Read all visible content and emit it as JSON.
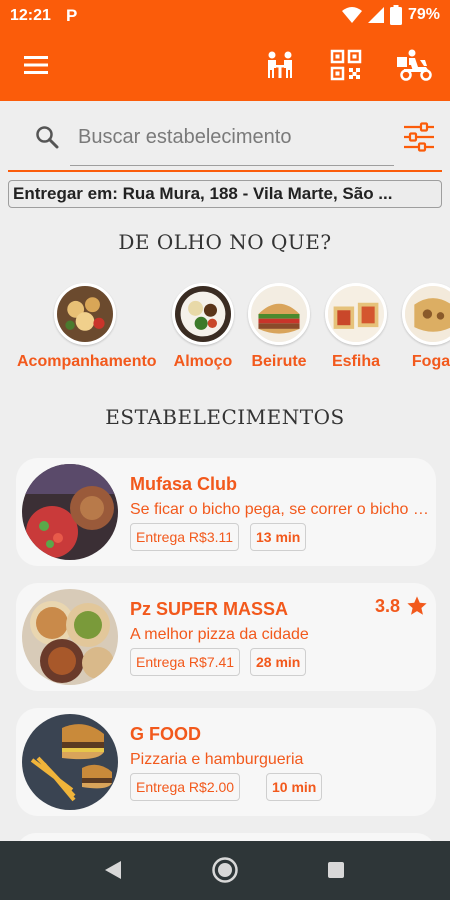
{
  "status_bar": {
    "time": "12:21",
    "app_icon_letter": "P",
    "battery": "79%"
  },
  "app_bar": {
    "menu_icon": "hamburger-menu-icon",
    "actions": [
      {
        "icon": "dine-in-table-icon"
      },
      {
        "icon": "qr-code-icon"
      },
      {
        "icon": "delivery-scooter-icon"
      }
    ]
  },
  "search": {
    "placeholder": "Buscar estabelecimento",
    "value": ""
  },
  "address": {
    "text": "Entregar em: Rua Mura, 188 - Vila Marte, São ..."
  },
  "categories_section": {
    "title": "DE OLHO NO QUE?",
    "items": [
      {
        "label": "Acompanhamento"
      },
      {
        "label": "Almoço"
      },
      {
        "label": "Beirute"
      },
      {
        "label": "Esfiha"
      },
      {
        "label": "Foga"
      }
    ]
  },
  "establishments_section": {
    "title": "ESTABELECIMENTOS",
    "items": [
      {
        "name": "Mufasa Club",
        "description": "Se ficar o bicho pega, se correr o bicho come",
        "delivery_fee": "Entrega R$3.11",
        "time": "13 min",
        "rating": ""
      },
      {
        "name": "Pz SUPER MASSA",
        "description": "A melhor pizza da cidade",
        "delivery_fee": "Entrega R$7.41",
        "time": "28 min",
        "rating": "3.8"
      },
      {
        "name": "G FOOD",
        "description": "Pizzaria e hamburgueria",
        "delivery_fee": "Entrega R$2.00",
        "time": "10 min",
        "rating": ""
      }
    ]
  },
  "colors": {
    "brand": "#fb5c0a",
    "accent_text": "#f2591c",
    "star": "#f2591c",
    "navbar": "#2e3638"
  }
}
